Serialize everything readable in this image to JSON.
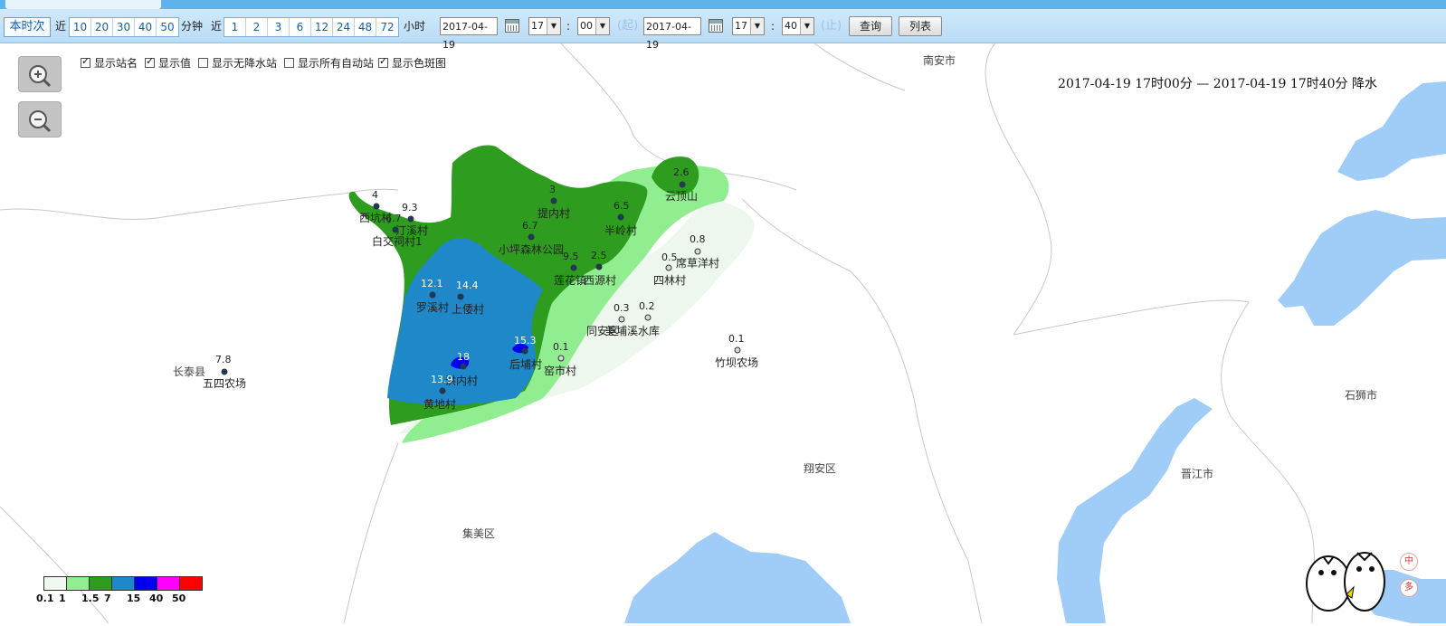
{
  "toolbar": {
    "current_btn": "本时次",
    "near_label": "近",
    "minute_options": [
      "10",
      "20",
      "30",
      "40",
      "50"
    ],
    "minute_unit": "分钟",
    "near_label2": "近",
    "hour_options": [
      "1",
      "2",
      "3",
      "6",
      "12",
      "24",
      "48",
      "72"
    ],
    "hour_unit": "小时",
    "start_date": "2017-04-19",
    "start_hour": "17",
    "start_min": "00",
    "colon": ":",
    "start_tag": "(起)",
    "end_date": "2017-04-19",
    "end_hour": "17",
    "end_min": "40",
    "end_tag": "(止)",
    "query_btn": "查询",
    "list_btn": "列表"
  },
  "options": [
    {
      "label": "显示站名",
      "checked": true
    },
    {
      "label": "显示值",
      "checked": true
    },
    {
      "label": "显示无降水站",
      "checked": false
    },
    {
      "label": "显示所有自动站",
      "checked": false
    },
    {
      "label": "显示色斑图",
      "checked": true
    }
  ],
  "map_title": "2017-04-19 17时00分 — 2017-04-19 17时40分 降水",
  "places": {
    "nanan": "南安市",
    "changtai": "长泰县",
    "xiangan": "翔安区",
    "jimei": "集美区",
    "jinjiang": "晋江市",
    "shishi": "石狮市"
  },
  "stations": [
    {
      "name": "西坑村",
      "value": "4"
    },
    {
      "name": "汀溪村",
      "value": "9.3"
    },
    {
      "name": "白交祠村1",
      "value": "6.7"
    },
    {
      "name": "提内村",
      "value": "3"
    },
    {
      "name": "半岭村",
      "value": "6.5"
    },
    {
      "name": "云顶山",
      "value": "2.6"
    },
    {
      "name": "小坪森林公园",
      "value": "6.7"
    },
    {
      "name": "莲花镇",
      "value": "9.5"
    },
    {
      "name": "西源村",
      "value": "2.5"
    },
    {
      "name": "席草洋村",
      "value": "0.8"
    },
    {
      "name": "四林村",
      "value": "0.5"
    },
    {
      "name": "罗溪村",
      "value": "12.1"
    },
    {
      "name": "上倭村",
      "value": "14.4"
    },
    {
      "name": "同安区",
      "value": "0.3"
    },
    {
      "name": "美埔溪水库",
      "value": "0.2"
    },
    {
      "name": "竹坝农场",
      "value": "0.1"
    },
    {
      "name": "后埔村",
      "value": "15.3"
    },
    {
      "name": "窑市村",
      "value": "0.1"
    },
    {
      "name": "五四农场",
      "value": "7.8"
    },
    {
      "name": "洪内村",
      "value": "18"
    },
    {
      "name": "黄地村",
      "value": "13.9"
    }
  ],
  "legend": {
    "colors": [
      "#f0f8f0",
      "#90ee90",
      "#2e9c1e",
      "#1f88c8",
      "#0000ee",
      "#ff00ff",
      "#ff0000"
    ],
    "labels": [
      "0.1",
      "1",
      "1.5",
      "7",
      "15",
      "40",
      "50"
    ]
  },
  "colors": {
    "water": "#9fcdf8",
    "toolbar": "#bfe0f8",
    "accent": "#1060b0"
  },
  "icons": {
    "zoom_in": "zoom-in-icon",
    "zoom_out": "zoom-out-icon",
    "calendar": "calendar-icon",
    "mascot": "mascot-icon"
  },
  "right_tools": [
    "中",
    "多"
  ]
}
